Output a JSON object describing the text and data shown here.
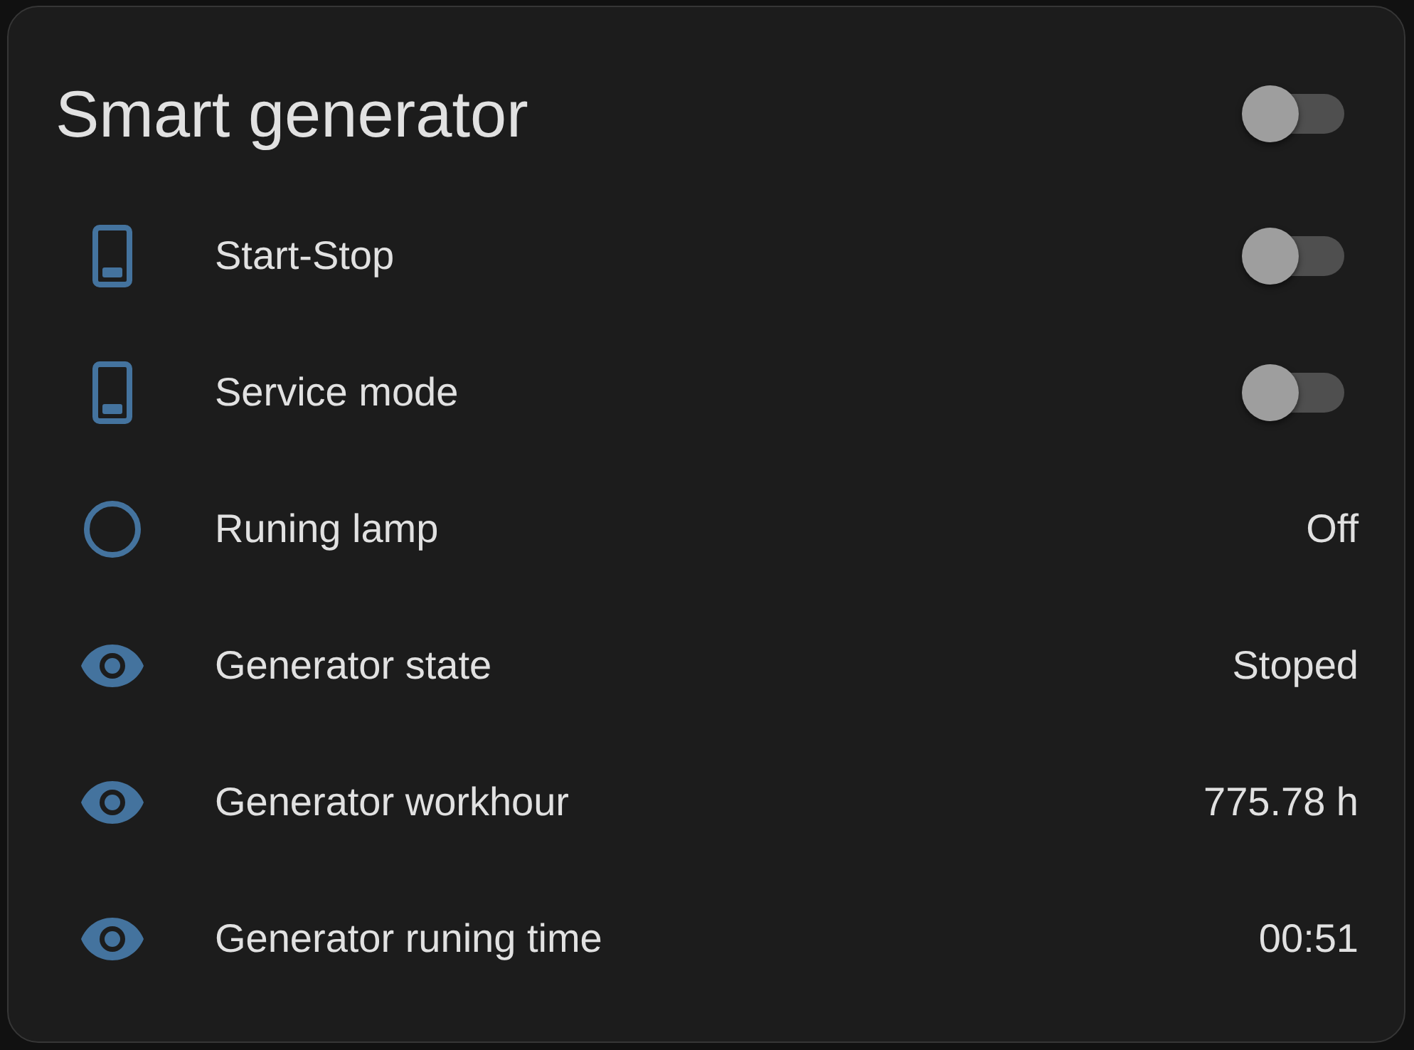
{
  "card": {
    "title": "Smart generator",
    "toggle": {
      "on": false
    }
  },
  "rows": [
    {
      "kind": "switch",
      "name": "Start-Stop",
      "on": false
    },
    {
      "kind": "switch",
      "name": "Service mode",
      "on": false
    },
    {
      "kind": "binary_sensor",
      "name": "Runing lamp",
      "value": "Off"
    },
    {
      "kind": "sensor",
      "name": "Generator state",
      "value": "Stoped"
    },
    {
      "kind": "sensor",
      "name": "Generator workhour",
      "value": "775.78 h"
    },
    {
      "kind": "sensor",
      "name": "Generator runing time",
      "value": "00:51"
    }
  ]
}
